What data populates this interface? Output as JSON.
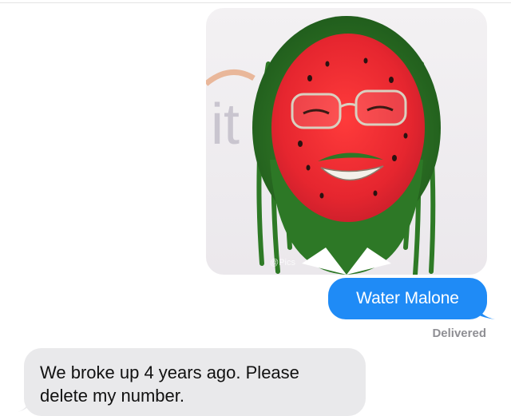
{
  "conversation": {
    "photo": {
      "subject": "watermelon-face-man-photo",
      "background_letters": "it",
      "watermark": "@Pics"
    },
    "sent_message": "Water Malone",
    "status": "Delivered",
    "received_message": "We broke up 4 years ago. Please delete my number."
  },
  "colors": {
    "sent_bubble": "#1f8bf6",
    "received_bubble": "#e9e9eb",
    "status_text": "#8f8f94"
  }
}
